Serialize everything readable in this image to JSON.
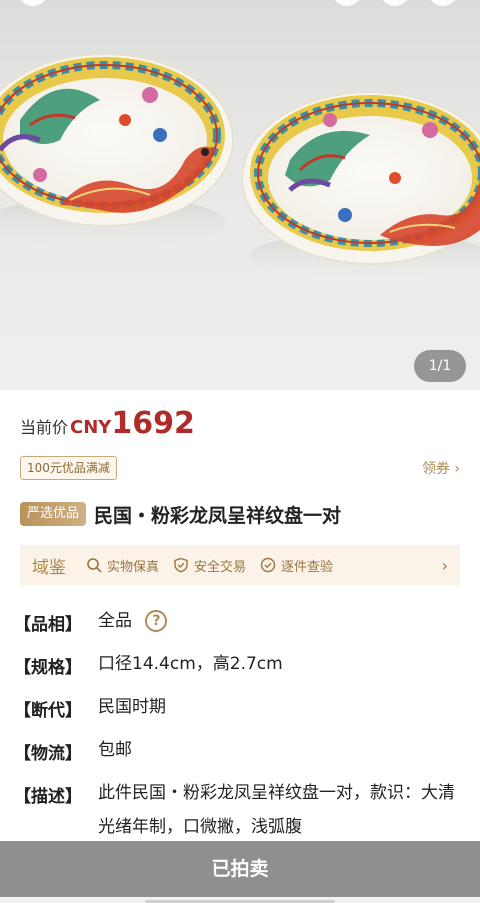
{
  "gallery": {
    "counter": "1/1",
    "image_subject": "pair of famille rose dragon and phoenix plates"
  },
  "price": {
    "label": "当前价",
    "currency": "CNY",
    "value": "1692"
  },
  "coupon": {
    "badge": "100元优品满减",
    "link": "领券 ›"
  },
  "title": {
    "badge": "严选优品",
    "text": "民国・粉彩龙凤呈祥纹盘一对"
  },
  "guarantee": {
    "brand": "域鉴",
    "items": [
      {
        "label": "实物保真",
        "icon": "search-icon"
      },
      {
        "label": "安全交易",
        "icon": "shield-check-icon"
      },
      {
        "label": "逐件查验",
        "icon": "check-circle-icon"
      }
    ],
    "arrow": "›"
  },
  "specs": {
    "rows": [
      {
        "key": "【品相】",
        "value": "全品"
      },
      {
        "key": "【规格】",
        "value": "口径14.4cm，高2.7cm"
      },
      {
        "key": "【断代】",
        "value": "民国时期"
      },
      {
        "key": "【物流】",
        "value": "包邮"
      },
      {
        "key": "【描述】",
        "value": "此件民国・粉彩龙凤呈祥纹盘一对，款识：大清光绪年制，口微撇，浅弧腹"
      }
    ]
  },
  "bottom": {
    "status": "已拍卖"
  },
  "colors": {
    "price": "#b02a2a",
    "accent_gold": "#b08a57",
    "guarantee_bg": "#fbf3e7",
    "sold_bar": "#8f8f8f"
  }
}
